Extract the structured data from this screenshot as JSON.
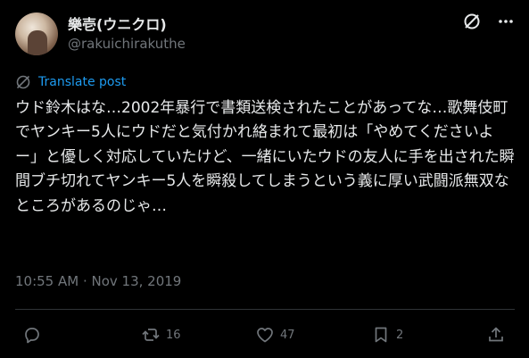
{
  "author": {
    "name": "樂壱(ウニクロ)",
    "handle": "@rakuichirakuthe"
  },
  "translate_label": "Translate post",
  "post_text": "ウド鈴木はな…2002年暴行で書類送検されたことがあってな…歌舞伎町でヤンキー5人にウドだと気付かれ絡まれて最初は「やめてくださいよー」と優しく対応していたけど、一緒にいたウドの友人に手を出された瞬間ブチ切れてヤンキー5人を瞬殺してしまうという義に厚い武闘派無双なところがあるのじゃ…",
  "timestamp": "10:55 AM · Nov 13, 2019",
  "actions": {
    "reply_count": "",
    "repost_count": "16",
    "like_count": "47",
    "bookmark_count": "2"
  },
  "icons": [
    "grok-icon",
    "more-icon",
    "globe-translate-icon",
    "reply-icon",
    "repost-icon",
    "like-icon",
    "bookmark-icon",
    "share-icon"
  ],
  "colors": {
    "background": "#000000",
    "text": "#e7e9ea",
    "muted": "#71767b",
    "link": "#1d9bf0",
    "divider": "#2f3336"
  }
}
